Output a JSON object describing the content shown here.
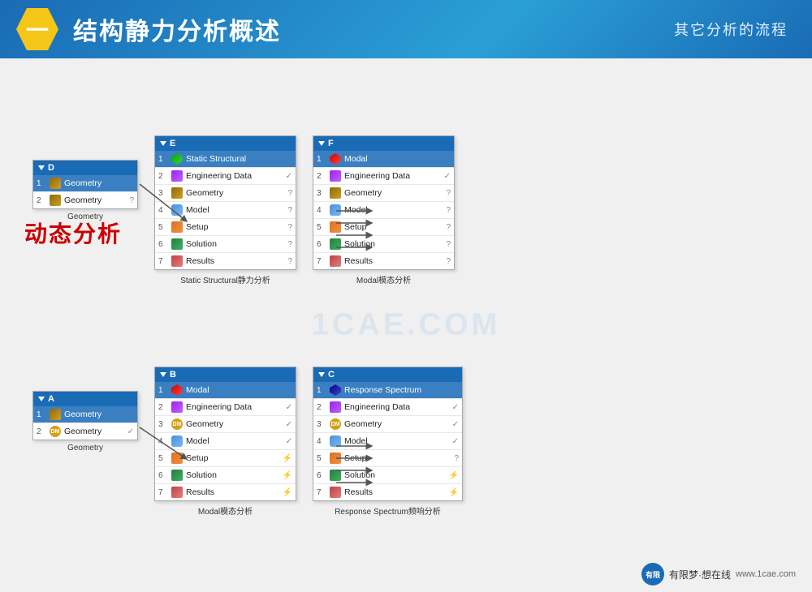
{
  "header": {
    "hex_label": "一",
    "title": "结构静力分析概述",
    "subtitle": "其它分析的流程"
  },
  "watermark": "1CAE.COM",
  "dynamic_label": "动态分析",
  "top": {
    "block_d": {
      "header": "D",
      "rows": [
        {
          "num": "1",
          "icon": "geo",
          "label": "Geometry",
          "status": "",
          "highlight": true
        },
        {
          "num": "2",
          "icon": "geo",
          "label": "Geometry",
          "status": "?",
          "highlight": false
        }
      ],
      "caption": "Geometry"
    },
    "block_e": {
      "header": "E",
      "rows": [
        {
          "num": "1",
          "icon": "ss",
          "label": "Static Structural",
          "status": "",
          "highlight": true
        },
        {
          "num": "2",
          "icon": "eng",
          "label": "Engineering Data",
          "status": "✓",
          "highlight": false
        },
        {
          "num": "3",
          "icon": "geo",
          "label": "Geometry",
          "status": "?",
          "highlight": false
        },
        {
          "num": "4",
          "icon": "model",
          "label": "Model",
          "status": "?",
          "highlight": false
        },
        {
          "num": "5",
          "icon": "setup",
          "label": "Setup",
          "status": "?",
          "highlight": false
        },
        {
          "num": "6",
          "icon": "sol",
          "label": "Solution",
          "status": "?",
          "highlight": false
        },
        {
          "num": "7",
          "icon": "results",
          "label": "Results",
          "status": "?",
          "highlight": false
        }
      ],
      "caption": "Static Structural静力分析"
    },
    "block_f": {
      "header": "F",
      "rows": [
        {
          "num": "1",
          "icon": "modal",
          "label": "Modal",
          "status": "",
          "highlight": true
        },
        {
          "num": "2",
          "icon": "eng",
          "label": "Engineering Data",
          "status": "✓",
          "highlight": false
        },
        {
          "num": "3",
          "icon": "geo",
          "label": "Geometry",
          "status": "?",
          "highlight": false
        },
        {
          "num": "4",
          "icon": "model",
          "label": "Model",
          "status": "?",
          "highlight": false
        },
        {
          "num": "5",
          "icon": "setup",
          "label": "Setup",
          "status": "?",
          "highlight": false
        },
        {
          "num": "6",
          "icon": "sol",
          "label": "Solution",
          "status": "?",
          "highlight": false
        },
        {
          "num": "7",
          "icon": "results",
          "label": "Results",
          "status": "?",
          "highlight": false
        }
      ],
      "caption": "Modal模态分析"
    }
  },
  "bottom": {
    "block_a": {
      "header": "A",
      "rows": [
        {
          "num": "1",
          "icon": "geo",
          "label": "Geometry",
          "status": "",
          "highlight": true
        },
        {
          "num": "2",
          "icon": "om",
          "label": "Geometry",
          "status": "✓",
          "highlight": false
        }
      ],
      "caption": "Geometry"
    },
    "block_b": {
      "header": "B",
      "rows": [
        {
          "num": "1",
          "icon": "modal",
          "label": "Modal",
          "status": "",
          "highlight": true
        },
        {
          "num": "2",
          "icon": "eng",
          "label": "Engineering Data",
          "status": "✓",
          "highlight": false
        },
        {
          "num": "3",
          "icon": "om",
          "label": "Geometry",
          "status": "✓",
          "highlight": false
        },
        {
          "num": "4",
          "icon": "model",
          "label": "Model",
          "status": "✓",
          "highlight": false
        },
        {
          "num": "5",
          "icon": "setup",
          "label": "Setup",
          "status": "⚡",
          "highlight": false
        },
        {
          "num": "6",
          "icon": "sol",
          "label": "Solution",
          "status": "⚡",
          "highlight": false
        },
        {
          "num": "7",
          "icon": "results",
          "label": "Results",
          "status": "⚡",
          "highlight": false
        }
      ],
      "caption": "Modal模态分析"
    },
    "block_c": {
      "header": "C",
      "rows": [
        {
          "num": "1",
          "icon": "rs",
          "label": "Response Spectrum",
          "status": "",
          "highlight": true
        },
        {
          "num": "2",
          "icon": "eng",
          "label": "Engineering Data",
          "status": "✓",
          "highlight": false
        },
        {
          "num": "3",
          "icon": "om",
          "label": "Geometry",
          "status": "✓",
          "highlight": false
        },
        {
          "num": "4",
          "icon": "model",
          "label": "Model",
          "status": "✓",
          "highlight": false
        },
        {
          "num": "5",
          "icon": "setup",
          "label": "Setup",
          "status": "?",
          "highlight": false
        },
        {
          "num": "6",
          "icon": "sol",
          "label": "Solution",
          "status": "⚡",
          "highlight": false
        },
        {
          "num": "7",
          "icon": "results",
          "label": "Results",
          "status": "⚡",
          "highlight": false
        }
      ],
      "caption": "Response Spectrum频响分析"
    }
  },
  "footer": {
    "logo_text": "有限",
    "site": "www.1cae.com",
    "brand": "有限梦·想在线"
  }
}
